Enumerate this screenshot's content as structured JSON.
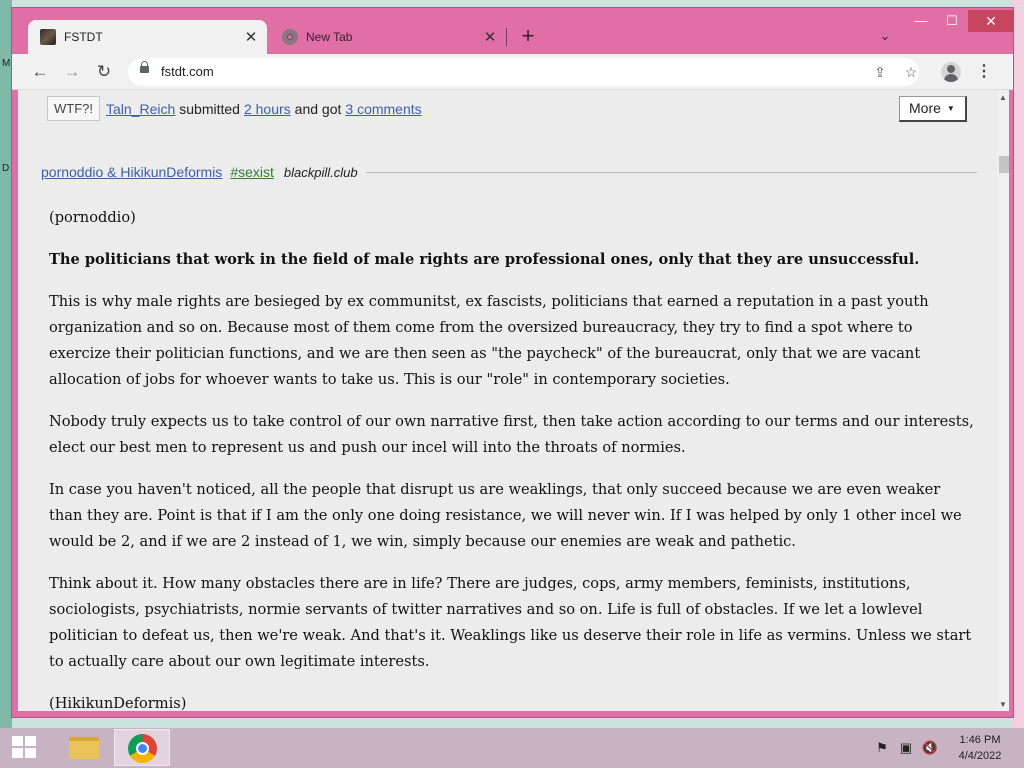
{
  "desktop": {
    "glyph_top": "M",
    "glyph_mid": "D"
  },
  "browser": {
    "tabs": [
      {
        "label": "FSTDT",
        "close": "✕"
      },
      {
        "label": "New Tab",
        "close": "✕"
      }
    ],
    "new_tab": "+",
    "tab_search": "⌄",
    "window_buttons": {
      "minimize": "—",
      "maximize": "☐",
      "close": "✕"
    },
    "toolbar": {
      "back": "←",
      "forward": "→",
      "reload": "↻",
      "url": "fstdt.com",
      "share": "⇪",
      "bookmark": "☆",
      "menu": "⋮"
    }
  },
  "page": {
    "post_meta": {
      "badge": "WTF?!",
      "user": "Taln_Reich",
      "submitted": "submitted",
      "time": "2 hours",
      "and_got": "and got",
      "comments": "3 comments",
      "more_button": "More",
      "more_caret": "▼"
    },
    "quote": {
      "authors": "pornoddio & HikikunDeformis",
      "tag": "#sexist",
      "site": "blackpill.club",
      "paragraphs": [
        "(pornoddio)",
        "The politicians that work in the field of male rights are professional ones, only that they are unsuccessful.",
        "This is why male rights are besieged by ex communitst, ex fascists, politicians that earned a reputation in a past youth organization and so on. Because most of them come from the oversized bureaucracy, they try to find a spot where to exercize their politician functions, and we are then seen as \"the paycheck\" of the bureaucrat, only that we are vacant allocation of jobs for whoever wants to take us. This is our \"role\" in contemporary societies.",
        "Nobody truly expects us to take control of our own narrative first, then take action according to our terms and our interests, elect our best men to represent us and push our incel will into the throats of normies.",
        "In case you haven't noticed, all the people that disrupt us are weaklings, that only succeed because we are even weaker than they are. Point is that if I am the only one doing resistance, we will never win. If I was helped by only 1 other incel we would be 2, and if we are 2 instead of 1, we win, simply because our enemies are weak and pathetic.",
        "Think about it. How many obstacles there are in life? There are judges, cops, army members, feminists, institutions, sociologists, psychiatrists, normie servants of twitter narratives and so on. Life is full of obstacles. If we let a lowlevel politician to defeat us, then we're weak. And that's it. Weaklings like us deserve their role in life as vermins. Unless we start to actually care about our own legitimate interests.",
        "(HikikunDeformis)"
      ]
    },
    "scrollbar": {
      "up": "▲",
      "down": "▼"
    }
  },
  "taskbar": {
    "tray": {
      "flag": "⚑",
      "network": "▣",
      "volume": "🔇"
    },
    "time": "1:46 PM",
    "date": "4/4/2022"
  }
}
